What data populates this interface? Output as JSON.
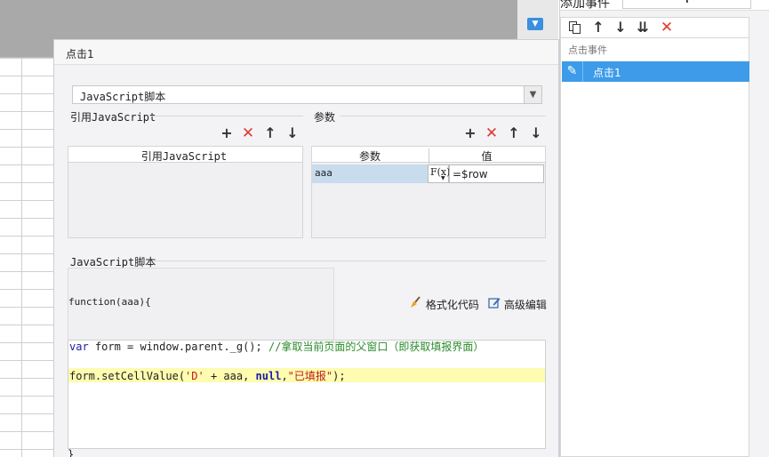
{
  "dialog": {
    "title": "点击1",
    "script_type": "JavaScript脚本",
    "ref_group_label": "引用JavaScript",
    "params_group_label": "参数",
    "ref_table_header": "引用JavaScript",
    "params_table": {
      "headers": [
        "参数",
        "值"
      ],
      "rows": [
        {
          "name": "aaa",
          "fx_label": "F(x)",
          "value": "=$row"
        }
      ]
    },
    "script_group_label": "JavaScript脚本",
    "function_signature": "function(aaa){",
    "format_code_label": "格式化代码",
    "advanced_edit_label": "高级编辑",
    "code": {
      "line1_kw": "var",
      "line1_rest": " form = window.parent._g(); ",
      "line1_comment": "//拿取当前页面的父窗口（即获取填报界面）",
      "line2_a": "form.setCellValue(",
      "line2_str1": "'D'",
      "line2_b": " + aaa, ",
      "line2_kw": "null",
      "line2_c": ",",
      "line2_str2": "\"已填报\"",
      "line2_d": ");"
    },
    "closing_brace": "}"
  },
  "right_panel": {
    "title": "添加事件",
    "group_label": "点击事件",
    "item_label": "点击1"
  },
  "colors": {
    "selection": "#3d9be9",
    "highlight_line": "#fdfcb0",
    "delete_red": "#e03a2e"
  }
}
